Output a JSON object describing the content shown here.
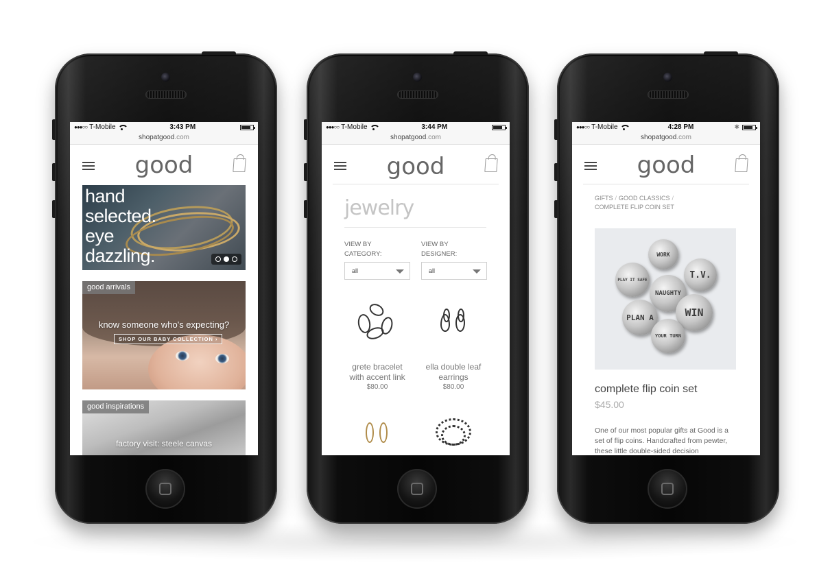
{
  "phones": [
    {
      "status": {
        "carrier": "T-Mobile",
        "time": "3:43 PM"
      },
      "url": {
        "host": "shopatgood",
        "tld": ".com"
      },
      "logo": "good",
      "hero": {
        "lines": [
          "hand",
          "selected.",
          "eye",
          "dazzling."
        ],
        "slides": 3,
        "active_slide": 2
      },
      "arrivals": {
        "tag": "good arrivals",
        "headline": "know someone who's expecting?",
        "cta": "SHOP OUR BABY COLLECTION  ›"
      },
      "inspirations": {
        "tag": "good inspirations",
        "headline": "factory visit: steele canvas"
      }
    },
    {
      "status": {
        "carrier": "T-Mobile",
        "time": "3:44 PM"
      },
      "url": {
        "host": "shopatgood",
        "tld": ".com"
      },
      "logo": "good",
      "page_title": "jewelry",
      "filters": [
        {
          "label_line1": "VIEW BY",
          "label_line2": "CATEGORY:",
          "value": "all"
        },
        {
          "label_line1": "VIEW BY",
          "label_line2": "DESIGNER:",
          "value": "all"
        }
      ],
      "products": [
        {
          "name_line1": "grete bracelet",
          "name_line2": "with accent link",
          "price": "$80.00"
        },
        {
          "name_line1": "ella double leaf",
          "name_line2": "earrings",
          "price": "$80.00"
        }
      ]
    },
    {
      "status": {
        "carrier": "T-Mobile",
        "time": "4:28 PM"
      },
      "url": {
        "host": "shopatgood",
        "tld": ".com"
      },
      "logo": "good",
      "breadcrumb": {
        "item1": "GIFTS",
        "item2": "GOOD CLASSICS",
        "item3": "COMPLETE FLIP COIN SET"
      },
      "coins": [
        "WORK",
        "PLAY IT SAFE",
        "T.V.",
        "NAUGHTY",
        "PLAN A",
        "WIN",
        "YOUR TURN"
      ],
      "product": {
        "title": "complete flip coin set",
        "price": "$45.00",
        "description": "One of our most popular gifts at Good is a set of flip coins. Handcrafted from pewter, these little double-sided decision"
      }
    }
  ],
  "icons": {
    "menu": "hamburger-icon",
    "cart": "shopping-bag-icon",
    "wifi": "wifi-icon",
    "battery": "battery-icon",
    "bluetooth": "bluetooth-icon",
    "dropdown": "chevron-down-icon",
    "home": "home-button-icon"
  }
}
